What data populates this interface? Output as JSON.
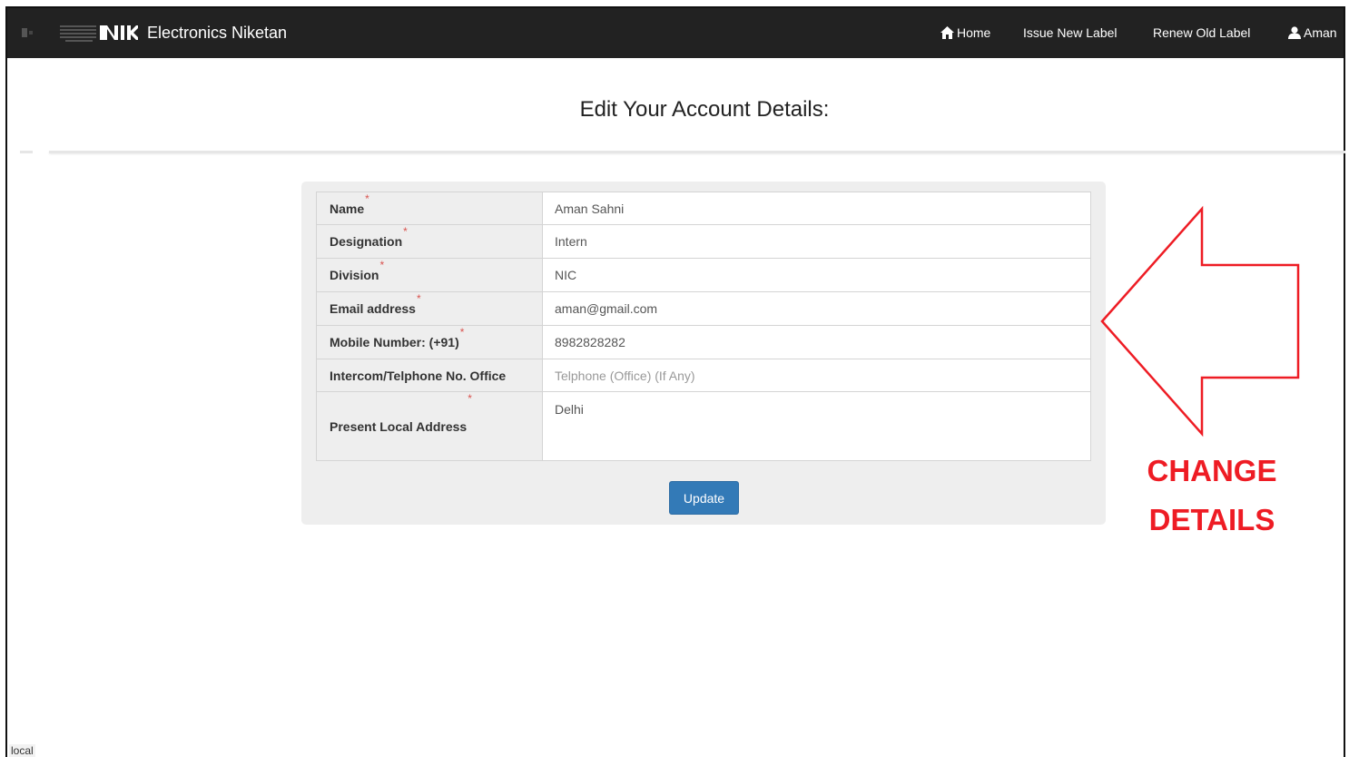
{
  "navbar": {
    "brand": "Electronics Niketan",
    "logo_text": "NIC",
    "items": [
      {
        "label": "Home",
        "icon": "home-icon"
      },
      {
        "label": "Issue New Label"
      },
      {
        "label": "Renew Old Label"
      },
      {
        "label": "Aman",
        "icon": "user-icon"
      }
    ]
  },
  "page_title": "Edit Your Account Details:",
  "form": {
    "fields": [
      {
        "label": "Name",
        "required": "*",
        "value": "Aman Sahni",
        "placeholder": ""
      },
      {
        "label": "Designation",
        "required": "*",
        "value": "Intern",
        "placeholder": ""
      },
      {
        "label": "Division",
        "required": "*",
        "value": "NIC",
        "placeholder": ""
      },
      {
        "label": "Email address",
        "required": "*",
        "value": "aman@gmail.com",
        "placeholder": ""
      },
      {
        "label": "Mobile Number: (+91)",
        "required": "*",
        "value": "8982828282",
        "placeholder": ""
      },
      {
        "label": "Intercom/Telphone No. Office",
        "required": "",
        "value": "",
        "placeholder": "Telphone (Office) (If Any)"
      },
      {
        "label": "Present Local Address",
        "required": "*",
        "value": "Delhi",
        "placeholder": ""
      }
    ],
    "submit_label": "Update"
  },
  "annotation": {
    "line1": "CHANGE",
    "line2": "DETAILS",
    "color": "#ee1c24"
  },
  "status_bar": "local",
  "colors": {
    "navbar": "#222222",
    "primary_button": "#337ab7",
    "required_star": "#d9534f"
  }
}
